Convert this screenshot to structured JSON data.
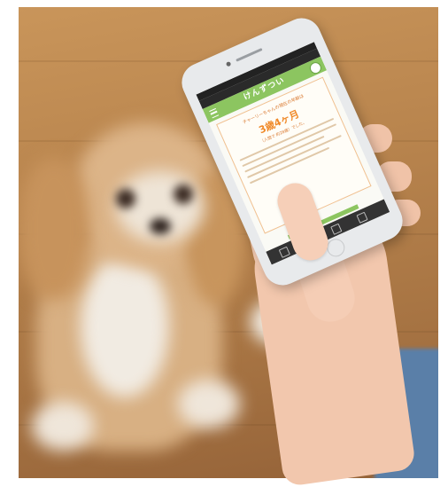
{
  "scene": {
    "description_type": "photo",
    "subjects": [
      "dog",
      "hand",
      "smartphone"
    ]
  },
  "phone_screen": {
    "app_title": "けんずつい",
    "card_line1": "チャーリーちゃんの現在の年齢は",
    "age_value": "3歳4ヶ月",
    "card_line2": "（人間で 約28歳）でした。"
  },
  "colors": {
    "floor": "#b9854e",
    "header_green": "#8cc560",
    "accent_orange": "#f08a2a"
  },
  "icons": {
    "menu": "menu-icon",
    "account": "avatar-icon"
  }
}
